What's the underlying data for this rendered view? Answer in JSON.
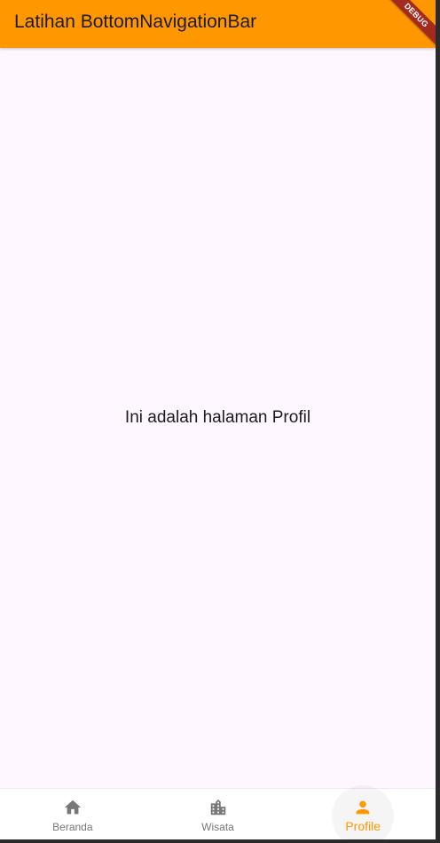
{
  "app_bar": {
    "title": "Latihan BottomNavigationBar",
    "debug_banner": "DEBUG"
  },
  "body": {
    "message": "Ini adalah halaman Profil"
  },
  "bottom_nav": {
    "items": [
      {
        "label": "Beranda",
        "icon": "home-icon",
        "active": false
      },
      {
        "label": "Wisata",
        "icon": "city-buildings-icon",
        "active": false
      },
      {
        "label": "Profile",
        "icon": "person-icon",
        "active": true
      }
    ]
  },
  "colors": {
    "accent": "#ff9800",
    "background": "#fef7ff",
    "inactive": "#777777",
    "debug_banner": "#a52a1e"
  }
}
